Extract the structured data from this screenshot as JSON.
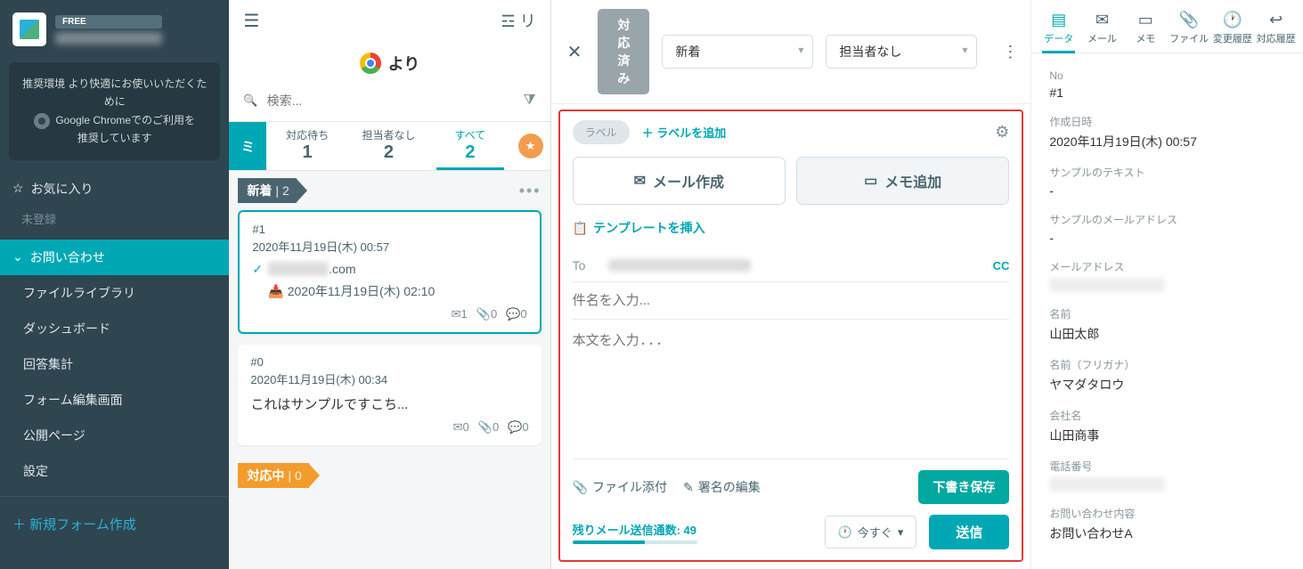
{
  "sidebar": {
    "free_badge": "FREE",
    "env_line1": "推奨環境 より快適にお使いいただくために",
    "env_line2": "Google Chromeでのご利用を",
    "env_line3": "推奨しています",
    "fav_header": "お気に入り",
    "fav_empty": "未登録",
    "inquiry": "お問い合わせ",
    "menu": [
      "ファイルライブラリ",
      "ダッシュボード",
      "回答集計",
      "フォーム編集画面",
      "公開ページ",
      "設定"
    ],
    "new_form": "新規フォーム作成"
  },
  "col2": {
    "yori": "より",
    "search_placeholder": "検索...",
    "tabs": [
      {
        "label": "対応待ち",
        "count": "1"
      },
      {
        "label": "担当者なし",
        "count": "2"
      },
      {
        "label": "すべて",
        "count": "2"
      }
    ],
    "section_new": "新着",
    "section_new_count": "2",
    "section_prog": "対応中",
    "section_prog_count": "0",
    "cards": [
      {
        "id": "#1",
        "ts": "2020年11月19日(木) 00:57",
        "from_suffix": ".com",
        "inbox_ts": "2020年11月19日(木) 02:10",
        "mail": "1",
        "attach": "0",
        "comment": "0"
      },
      {
        "id": "#0",
        "ts": "2020年11月19日(木) 00:34",
        "snip": "これはサンプルですこち...",
        "mail": "0",
        "attach": "0",
        "comment": "0"
      }
    ]
  },
  "center": {
    "status": "対応済み",
    "sel1": "新着",
    "sel2": "担当者なし",
    "label_pill": "ラベル",
    "add_label": "ラベルを追加",
    "tab_mail": "メール作成",
    "tab_memo": "メモ追加",
    "template": "テンプレートを挿入",
    "to_label": "To",
    "cc": "CC",
    "subject_ph": "件名を入力...",
    "body_ph": "本文を入力...",
    "attach": "ファイル添付",
    "signature": "署名の編集",
    "draft": "下書き保存",
    "quota": "残りメール送信通数: 49",
    "schedule": "今すぐ",
    "send": "送信"
  },
  "right": {
    "tabs": [
      "データ",
      "メール",
      "メモ",
      "ファイル",
      "変更履歴",
      "対応履歴"
    ],
    "fields": [
      {
        "label": "No",
        "val": "#1"
      },
      {
        "label": "作成日時",
        "val": "2020年11月19日(木) 00:57"
      },
      {
        "label": "サンプルのテキスト",
        "val": "-"
      },
      {
        "label": "サンプルのメールアドレス",
        "val": "-"
      },
      {
        "label": "メールアドレス",
        "val": "",
        "blur": true
      },
      {
        "label": "名前",
        "val": "山田太郎"
      },
      {
        "label": "名前（フリガナ）",
        "val": "ヤマダタロウ"
      },
      {
        "label": "会社名",
        "val": "山田商事"
      },
      {
        "label": "電話番号",
        "val": "",
        "blur": true
      },
      {
        "label": "お問い合わせ内容",
        "val": "お問い合わせA"
      }
    ]
  }
}
